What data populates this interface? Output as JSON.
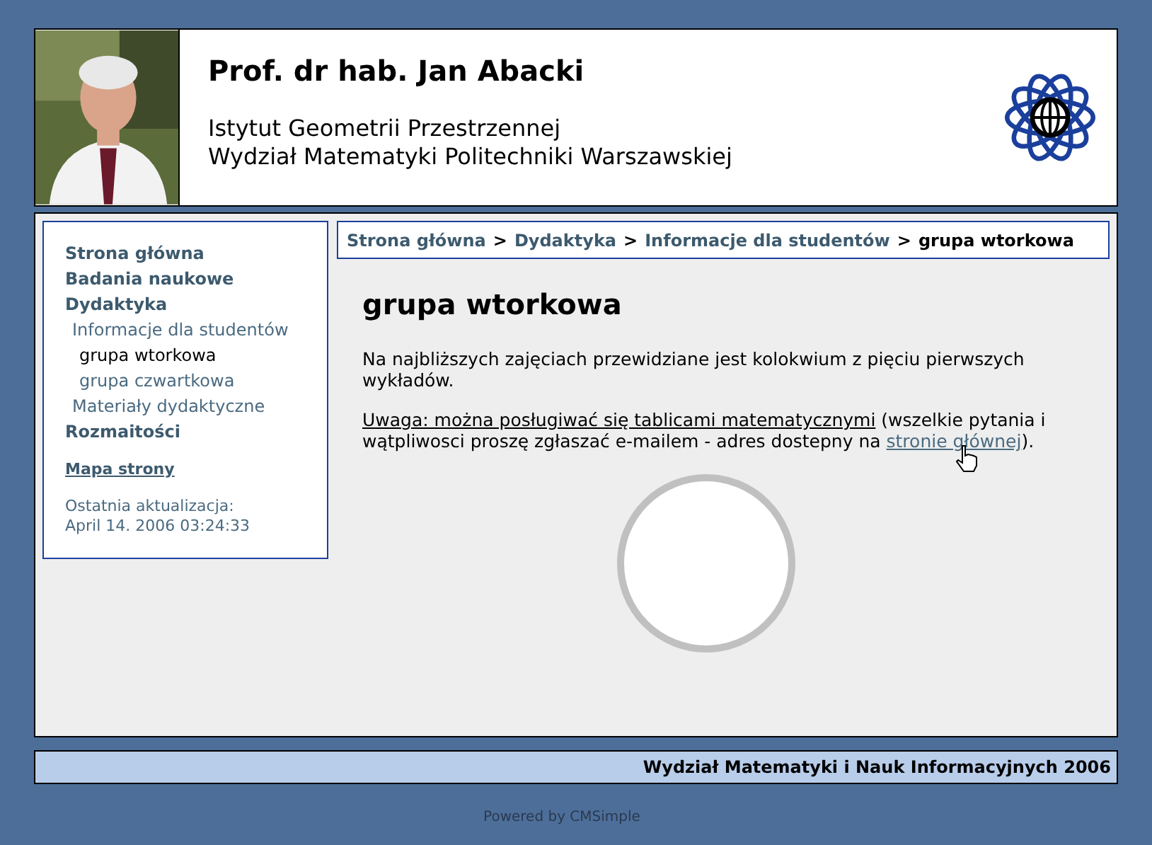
{
  "header": {
    "name": "Prof. dr hab. Jan Abacki",
    "institute": "Istytut Geometrii Przestrzennej",
    "faculty": "Wydział Matematyki Politechniki Warszawskiej"
  },
  "sidebar": {
    "items": [
      {
        "label": "Strona główna",
        "selected": false
      },
      {
        "label": "Badania naukowe",
        "selected": false
      },
      {
        "label": "Dydaktyka",
        "selected": false,
        "children": [
          {
            "label": "Informacje dla studentów",
            "selected": false,
            "children": [
              {
                "label": "grupa wtorkowa",
                "selected": true
              },
              {
                "label": "grupa czwartkowa",
                "selected": false
              }
            ]
          },
          {
            "label": "Materiały dydaktyczne",
            "selected": false
          }
        ]
      },
      {
        "label": "Rozmaitości",
        "selected": false
      }
    ],
    "sitemap": "Mapa strony",
    "updated_label": "Ostatnia aktualizacja:",
    "updated_date": "April 14. 2006 03:24:33"
  },
  "breadcrumb": {
    "links": [
      "Strona główna",
      "Dydaktyka",
      "Informacje dla studentów"
    ],
    "separator": ">",
    "current": "grupa wtorkowa"
  },
  "content": {
    "title": "grupa wtorkowa",
    "paragraph": "Na najbliższych zajęciach przewidziane jest kolokwium z pięciu pierwszych wykładów.",
    "note_link": "Uwaga: można posługiwać się tablicami matematycznymi",
    "note_text": "(wszelkie pytania i wątpliwosci proszę zgłaszać e-mailem - adres dostepny na",
    "note_link2": "stronie głównej",
    "note_end": ")."
  },
  "footer": "Wydział Matematyki i Nauk Informacyjnych 2006",
  "powered": "Powered by CMSimple"
}
